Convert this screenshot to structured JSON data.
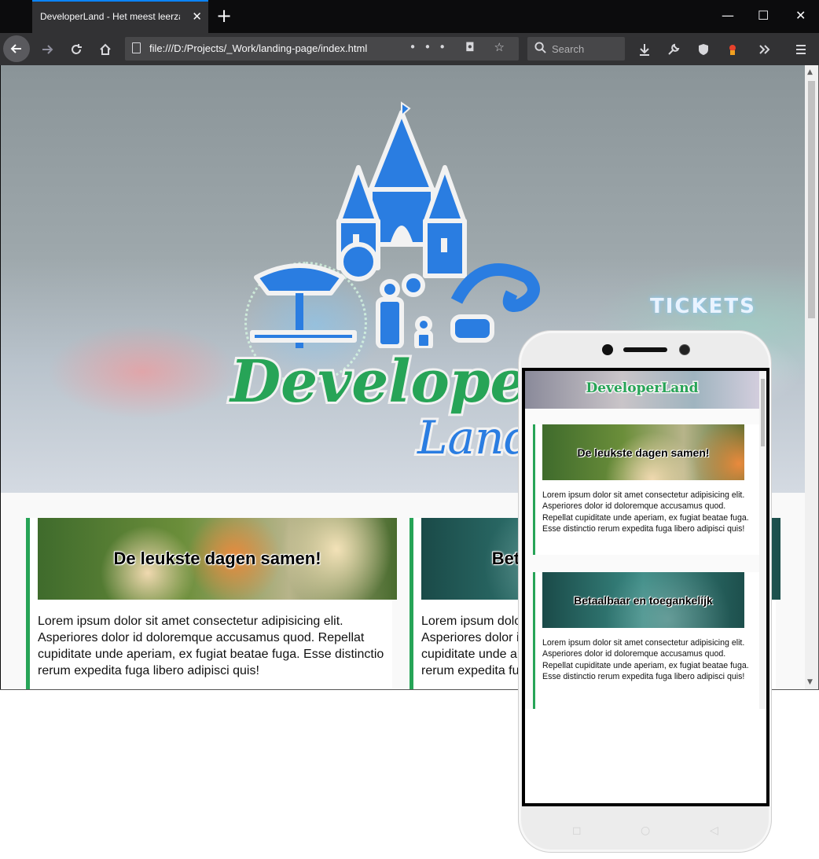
{
  "browser": {
    "tab_title": "DeveloperLand - Het meest leerzaam",
    "tab_close": "✕",
    "new_tab": "+",
    "window_controls": {
      "minimize": "—",
      "maximize": "☐",
      "close": "✕"
    },
    "url": "file:///D:/Projects/_Work/landing-page/index.html",
    "url_actions": "••• ◘ ☆",
    "search_placeholder": "Search",
    "icons": [
      "back-arrow-icon",
      "forward-arrow-icon",
      "reload-icon",
      "home-icon",
      "page-icon",
      "search-icon",
      "download-icon",
      "wrench-icon",
      "shield-icon",
      "extension-icon",
      "overflow-icon",
      "menu-icon"
    ]
  },
  "page": {
    "logo_title": "Developer",
    "logo_sub": "Land",
    "hero_sign": "TICKETS",
    "cards": [
      {
        "title": "De leukste dagen samen!",
        "text": "Lorem ipsum dolor sit amet consectetur adipisicing elit. Asperiores dolor id doloremque accusamus quod. Repellat cupiditate unde aperiam, ex fugiat beatae fuga. Esse distinctio rerum expedita fuga libero adipisci quis!"
      },
      {
        "title": "Betaalbaar en toegankelijk",
        "text": "Lorem ipsum dolor sit amet consectetur adipisicing elit. Asperiores dolor id doloremque accusamus quod. Repellat cupiditate unde aperiam, ex fugiat beatae fuga. Esse distinctio rerum expedita fuga libero adipisci quis!"
      }
    ]
  },
  "phone": {
    "site_title": "DeveloperLand",
    "nav": {
      "recent": "◻",
      "home": "○",
      "back": "◁"
    }
  },
  "colors": {
    "brand_green": "#27a457",
    "brand_blue": "#2a7de1",
    "chrome_dark": "#0c0c0d",
    "chrome_toolbar": "#323234"
  }
}
